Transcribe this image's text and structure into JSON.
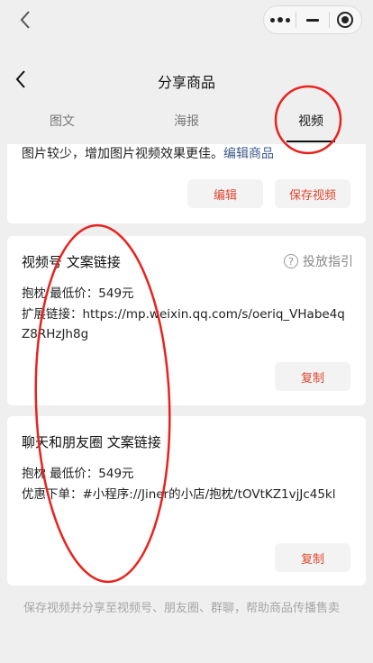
{
  "header": {
    "title": "分享商品"
  },
  "tabs": [
    {
      "label": "图文"
    },
    {
      "label": "海报"
    },
    {
      "label": "视频"
    }
  ],
  "video_card": {
    "tip_text": "图片较少，增加图片视频效果更佳。",
    "tip_link": "编辑商品",
    "edit_label": "编辑",
    "save_label": "保存视频"
  },
  "channels_card": {
    "title": "视频号 文案链接",
    "guide_label": "投放指引",
    "line1": "抱枕 最低价：549元",
    "line2": "扩展链接：https://mp.weixin.qq.com/s/oeriq_VHabe4qZ8RHzJh8g",
    "copy_label": "复制"
  },
  "chat_card": {
    "title": "聊天和朋友圈 文案链接",
    "line1": "抱枕 最低价：549元",
    "line2": "优惠下单：#小程序://Jiner的小店/抱枕/tOVtKZ1vjJc45kl",
    "copy_label": "复制"
  },
  "footer_note": "保存视频并分享至视频号、朋友圈、群聊，帮助商品传播售卖",
  "colors": {
    "accent": "#e0462f",
    "link": "#3d5a8a",
    "annotation": "#e8231e"
  }
}
